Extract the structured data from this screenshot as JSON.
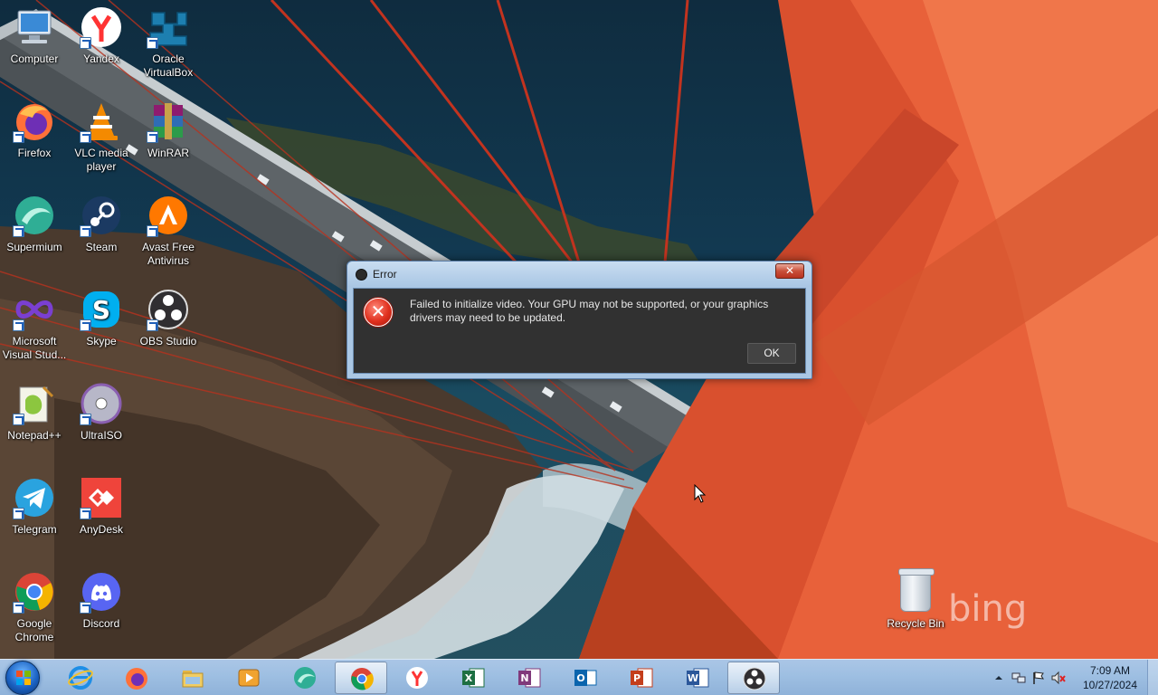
{
  "desktop": {
    "icons": [
      {
        "label": "Computer"
      },
      {
        "label": "Yandex"
      },
      {
        "label": "Oracle VirtualBox"
      },
      {
        "label": "Firefox"
      },
      {
        "label": "VLC media player"
      },
      {
        "label": "WinRAR"
      },
      {
        "label": "Supermium"
      },
      {
        "label": "Steam"
      },
      {
        "label": "Avast Free Antivirus"
      },
      {
        "label": "Microsoft Visual Stud..."
      },
      {
        "label": "Skype"
      },
      {
        "label": "OBS Studio"
      },
      {
        "label": "Notepad++"
      },
      {
        "label": "UltraISO"
      },
      {
        "label": "Telegram"
      },
      {
        "label": "AnyDesk"
      },
      {
        "label": "Google Chrome"
      },
      {
        "label": "Discord"
      }
    ],
    "recycle_bin": "Recycle Bin",
    "watermark": "bing"
  },
  "dialog": {
    "title": "Error",
    "close_glyph": "✕",
    "message": "Failed to initialize video.  Your GPU may not be supported, or your graphics drivers may need to be updated.",
    "ok_label": "OK"
  },
  "taskbar": {
    "clock_time": "7:09 AM",
    "clock_date": "10/27/2024"
  }
}
